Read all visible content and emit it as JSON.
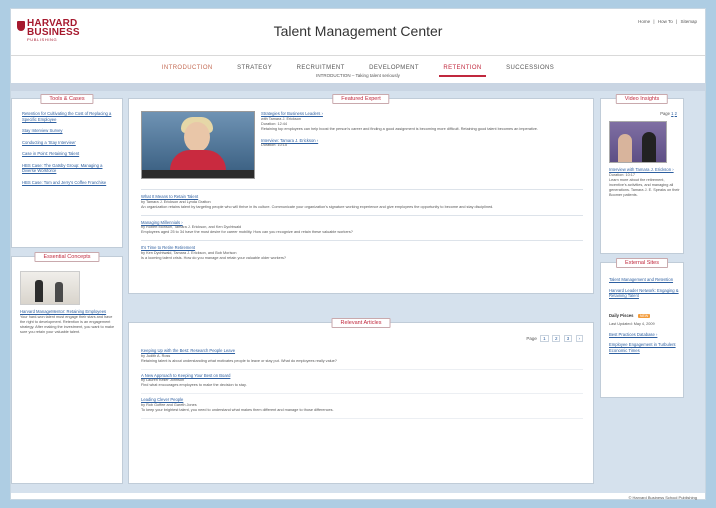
{
  "header": {
    "logo": {
      "line1": "HARVARD",
      "line2": "BUSINESS",
      "line3": "PUBLISHING"
    },
    "title": "Talent Management Center",
    "toplinks": [
      "Home",
      "|",
      "How To",
      "|",
      "Sitemap"
    ]
  },
  "nav": {
    "items": [
      {
        "label": "INTRODUCTION"
      },
      {
        "label": "STRATEGY"
      },
      {
        "label": "RECRUITMENT"
      },
      {
        "label": "DEVELOPMENT"
      },
      {
        "label": "RETENTION"
      },
      {
        "label": "SUCCESSIONS"
      }
    ],
    "active_index": 4,
    "breadcrumb": "INTRODUCTION – Taking talent seriously"
  },
  "tools_cases": {
    "title": "Tools & Cases",
    "items": [
      "Retention for Cultivating the Cost of Replacing a Specific Employee",
      "Stay Interview Survey",
      "Conducting a 'Stay Interview'",
      "Case in Point: Retaining Talent",
      "HBS Case: The Gatsby Group: Managing a Diverse Workforce",
      "HBS Case: Tom and Jerry's Coffee Franchise"
    ]
  },
  "essential_concepts": {
    "title": "Essential Concepts",
    "link": "Harvard ManageMentor: Retaining Employees",
    "text": "Your hard-won talent must engage their stars and have the right to development. Retention is an engagement strategy. After making the investment, you want to make sure you retain your valuable talent."
  },
  "featured_expert": {
    "title": "Featured Expert",
    "video_title": "Strategies for Business Leaders ›",
    "video_author": "with Tamara J. Erickson",
    "video_duration": "Duration: 12:44",
    "video_desc": "Retaining top employees can help boost the person's career and finding a good assignment is becoming more difficult. Retaining good talent becomes an imperative.",
    "audio_title": "Interview: Tamara J. Erickson ›",
    "audio_duration": "Duration: 10:15",
    "items": [
      {
        "title": "What It Means to Retain Talent",
        "author": "by Tamara J. Erickson and Lynda Gratton",
        "desc": "An organization retains talent by targeting people who will thrive in its culture. Communicate your organization's signature working experience and give employees the opportunity to become and stay disciplined."
      },
      {
        "title": "Managing Millennials ›",
        "author": "by Robert Morison, Tamara J. Erickson, and Ken Dychtwald",
        "desc": "Employees aged 25 to 34 have the most desire for career mobility. How can you recognize and retain these valuable workers?"
      },
      {
        "title": "It's Time to Retire Retirement",
        "author": "by Ken Dychtwald, Tamara J. Erickson, and Bob Morison",
        "desc": "Is a looming talent crisis. How do you manage and retain your valuable older workers?"
      }
    ]
  },
  "relevant_articles": {
    "title": "Relevant Articles",
    "pager": {
      "label": "Page",
      "pages": [
        "1",
        "2",
        "3",
        "›"
      ]
    },
    "items": [
      {
        "title": "Keeping Up with the Best: Research People Leave",
        "author": "by Judith A. Ross",
        "desc": "Retaining talent is about understanding what motivates people to leave or stay put. What do employees really value?"
      },
      {
        "title": "A New Approach to Keeping Your Best on Board",
        "author": "by Lauren Keller Johnson",
        "desc": "Find what encourages employees to make the decision to stay."
      },
      {
        "title": "Leading Clever People",
        "author": "by Rob Goffee and Gareth Jones",
        "desc": "To keep your brightest talent, you need to understand what makes them different and manage to those differences."
      }
    ]
  },
  "video_insights": {
    "title": "Video Insights",
    "pager": {
      "label": "Page",
      "pages": [
        "1",
        "2"
      ]
    },
    "link": "Interview with Tamara J. Erickson ›",
    "duration": "Duration: 10:17",
    "text": "Learn more about the retirement, incentive's activities, and managing all generations. Tamara J. E. Speaks on their Boomer patients."
  },
  "external_sites": {
    "title": "External Sites",
    "links": [
      "Talent Management and Retention",
      "Harvard Leader Network: Engaging & Retaining Talent"
    ],
    "feature_label": "Daily Pisces",
    "feature_badge": "NEW",
    "feature_sub": "Last Updated: May 4, 2009",
    "links2": [
      "Best Practices Database ›",
      "Employee Engagement in Turbulent Economic Times"
    ]
  },
  "footer": {
    "text": "© Harvard Business School Publishing"
  },
  "colors": {
    "brand_red": "#a6192e",
    "link_blue": "#2d5fa0",
    "page_bg": "#aecde3"
  }
}
